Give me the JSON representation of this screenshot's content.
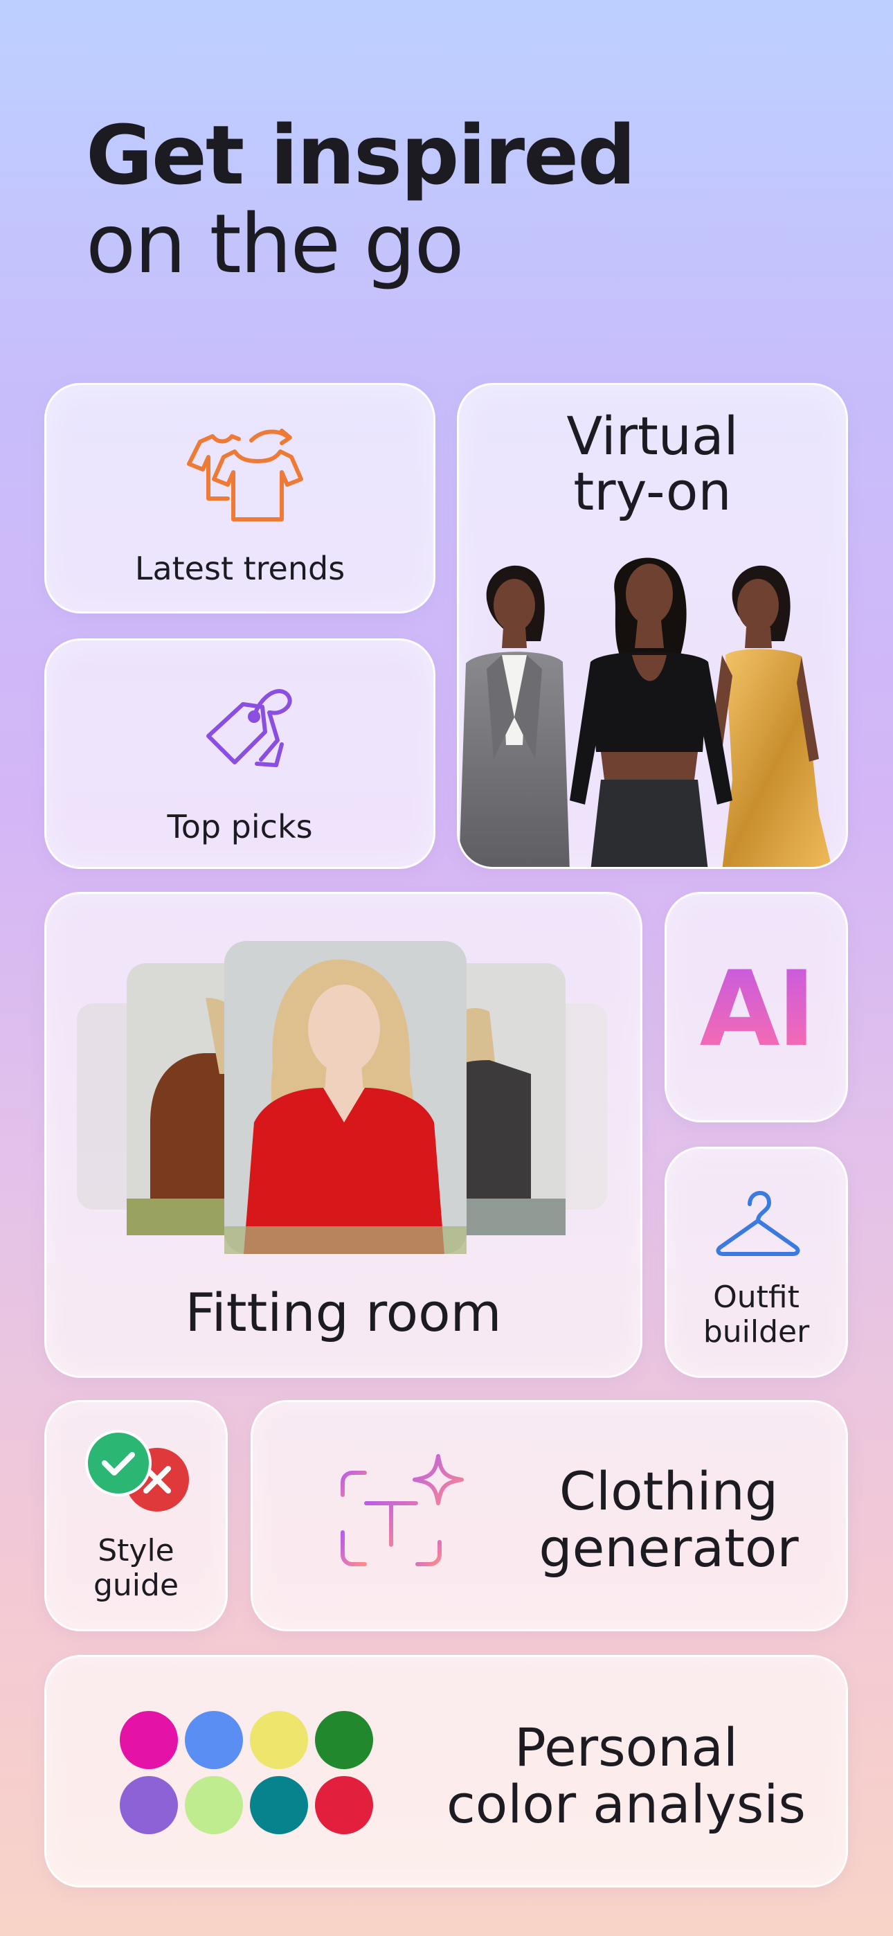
{
  "headline": {
    "line1": "Get inspired",
    "line2": "on the go"
  },
  "cards": {
    "latest_trends": {
      "label": "Latest trends",
      "icon": "shirts-icon",
      "accent": "#ee7b35"
    },
    "top_picks": {
      "label": "Top picks",
      "icon": "price-tags-icon",
      "accent": "#8a4fe0"
    },
    "virtual_tryon": {
      "line1": "Virtual",
      "line2": "try-on"
    },
    "fitting_room": {
      "label": "Fitting room"
    },
    "ai": {
      "label": "AI"
    },
    "outfit_builder": {
      "line1": "Outfit",
      "line2": "builder",
      "icon": "hanger-icon",
      "accent": "#3b7be0"
    },
    "style_guide": {
      "line1": "Style",
      "line2": "guide",
      "icon": "check-cross-icon"
    },
    "clothing_generator": {
      "line1": "Clothing",
      "line2": "generator",
      "icon": "text-sparkle-icon"
    },
    "color_analysis": {
      "line1": "Personal",
      "line2": "color analysis",
      "swatches": [
        "#e512a8",
        "#5b8ef2",
        "#ede56c",
        "#21882d",
        "#8d62d6",
        "#bfec8e",
        "#07838e",
        "#e21f3d"
      ]
    }
  }
}
